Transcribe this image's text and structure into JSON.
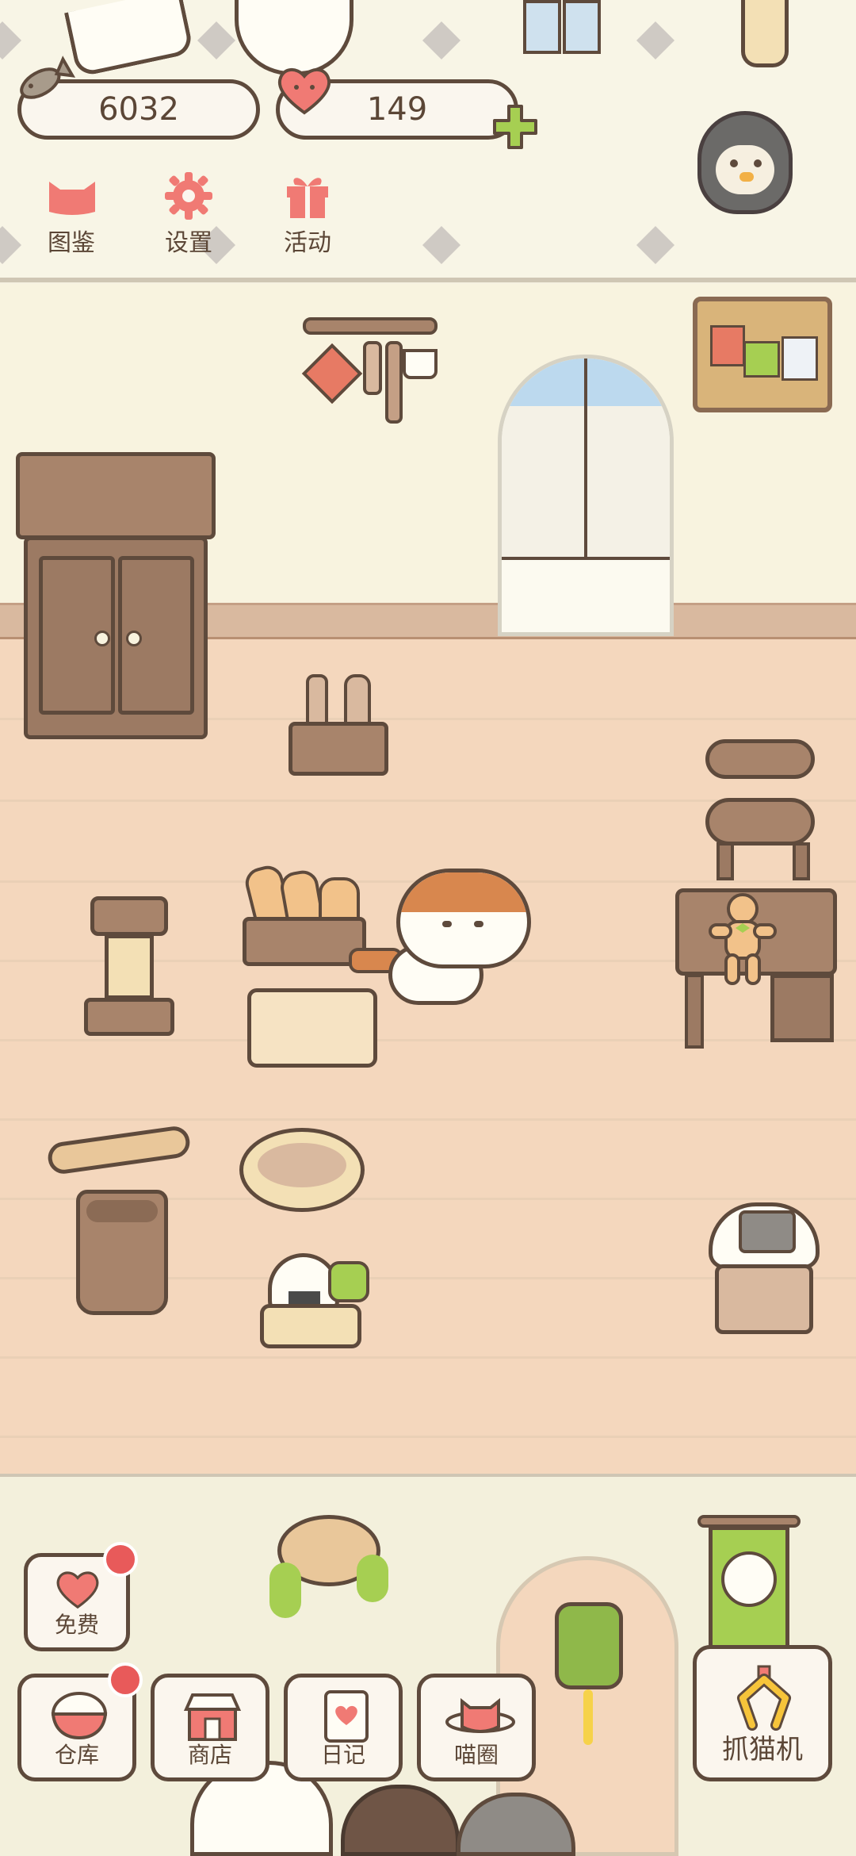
{
  "hud": {
    "fish_count": "6032",
    "heart_count": "149",
    "buttons": [
      {
        "label": "图鉴",
        "icon": "cat-head-icon"
      },
      {
        "label": "设置",
        "icon": "gear-icon"
      },
      {
        "label": "活动",
        "icon": "gift-icon"
      }
    ]
  },
  "bottom_menu": {
    "free_label": "免费",
    "warehouse_label": "仓库",
    "shop_label": "商店",
    "diary_label": "日记",
    "circle_label": "喵圈",
    "claw_label": "抓猫机"
  },
  "colors": {
    "accent_green": "#a6cf52",
    "heart_pink": "#f07a74",
    "badge_red": "#e85a5a",
    "outline_brown": "#5e4a3c"
  }
}
